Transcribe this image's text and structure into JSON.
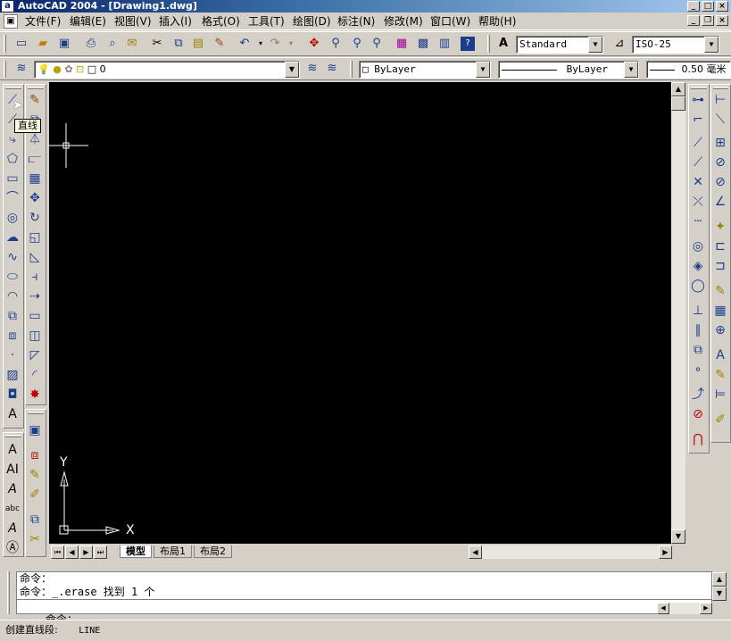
{
  "window": {
    "title": "AutoCAD 2004 - [Drawing1.dwg]",
    "app_icon": "a"
  },
  "menu": [
    "文件(F)",
    "编辑(E)",
    "视图(V)",
    "插入(I)",
    "格式(O)",
    "工具(T)",
    "绘图(D)",
    "标注(N)",
    "修改(M)",
    "窗口(W)",
    "帮助(H)"
  ],
  "standard_toolbar": {
    "text_style": "Standard",
    "dim_style": "ISO-25"
  },
  "layer_toolbar": {
    "current_layer": "0",
    "color": "ByLayer",
    "linetype": "ByLayer",
    "lineweight": "0.50 毫米"
  },
  "tooltip": "直线",
  "canvas": {
    "axis_x": "X",
    "axis_y": "Y",
    "background": "#000000"
  },
  "layout_tabs": [
    "模型",
    "布局1",
    "布局2"
  ],
  "command": {
    "lines": [
      "命令：",
      "命令：_.erase 找到 1 个"
    ],
    "prompt": "命令："
  },
  "status": {
    "label": "创建直线段:",
    "command": "LINE"
  },
  "icons": {
    "draw_toolbar": [
      "line-icon",
      "construction-line-icon",
      "polyline-icon",
      "polygon-icon",
      "rectangle-icon",
      "arc-icon",
      "circle-icon",
      "revision-cloud-icon",
      "spline-icon",
      "ellipse-icon",
      "ellipse-arc-icon",
      "insert-block-icon",
      "make-block-icon",
      "point-icon",
      "hatch-icon",
      "region-icon",
      "multiline-text-icon"
    ],
    "modify_toolbar": [
      "erase-icon",
      "copy-icon",
      "mirror-icon",
      "offset-icon",
      "array-icon",
      "move-icon",
      "rotate-icon",
      "scale-icon",
      "stretch-icon",
      "trim-icon",
      "extend-icon",
      "break-at-point-icon",
      "break-icon",
      "chamfer-icon",
      "fillet-icon",
      "explode-icon"
    ]
  }
}
